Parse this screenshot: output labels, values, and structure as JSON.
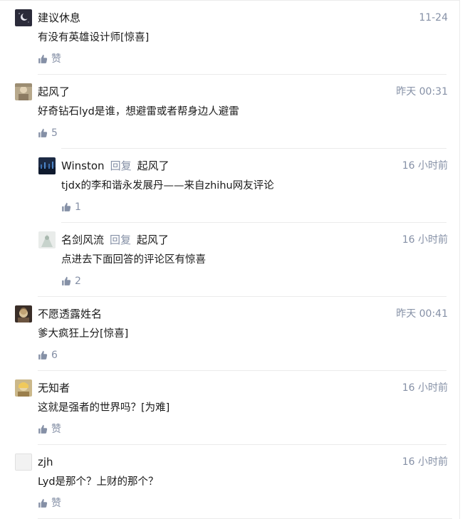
{
  "comments": [
    {
      "author": "建议休息",
      "time": "11-24",
      "content": "有没有英雄设计师[惊喜]",
      "likes": "赞"
    },
    {
      "author": "起风了",
      "time": "昨天 00:31",
      "content": "好奇钻石lyd是谁，想避雷或者帮身边人避雷",
      "likes": "5"
    },
    {
      "author": "Winston",
      "reply_word": "回复",
      "reply_to": "起风了",
      "time": "16 小时前",
      "content": "tjdx的李和谐永发展丹——来自zhihu网友评论",
      "likes": "1"
    },
    {
      "author": "名剑风流",
      "reply_word": "回复",
      "reply_to": "起风了",
      "time": "16 小时前",
      "content": "点进去下面回答的评论区有惊喜",
      "likes": "2"
    },
    {
      "author": "不愿透露姓名",
      "time": "昨天 00:41",
      "content": "爹大疯狂上分[惊喜]",
      "likes": "6"
    },
    {
      "author": "无知者",
      "time": "16 小时前",
      "content": "这就是强者的世界吗？[为难]",
      "likes": "赞"
    },
    {
      "author": "zjh",
      "time": "16 小时前",
      "content": "Lyd是那个？上财的那个？",
      "likes": "赞"
    }
  ],
  "colors": {
    "meta": "#8590a6",
    "text": "#1a1a1a",
    "divider": "#ebebeb"
  },
  "icons": {
    "like": "thumbs-up-icon"
  }
}
